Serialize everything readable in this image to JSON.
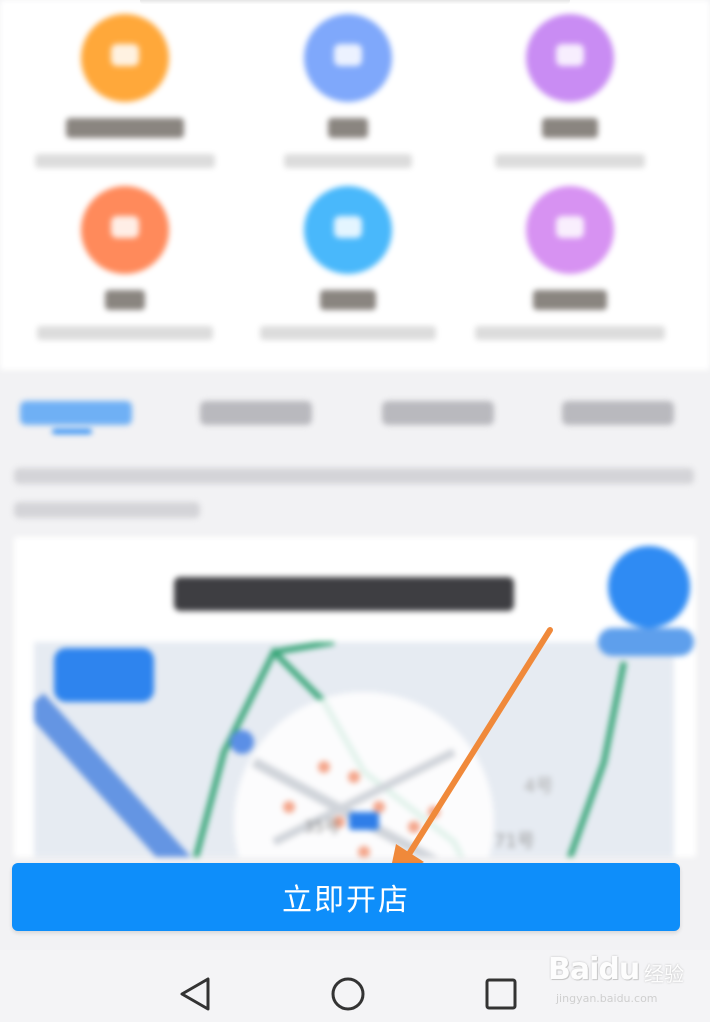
{
  "colors": {
    "accent": "#0e8efa",
    "arrow": "#f0893a",
    "feature_circles": [
      "#ffa83a",
      "#7fa8fb",
      "#c98cf3",
      "#ff8a5b",
      "#49b8fb",
      "#d792f2"
    ]
  },
  "feature_grid": {
    "items": [
      {
        "icon": "sparkle-icon",
        "title": "",
        "desc": ""
      },
      {
        "icon": "cart-icon",
        "title": "",
        "desc": ""
      },
      {
        "icon": "gift-icon",
        "title": "",
        "desc": ""
      },
      {
        "icon": "hand-icon",
        "title": "",
        "desc": ""
      },
      {
        "icon": "coupon-icon",
        "title": "",
        "desc": ""
      },
      {
        "icon": "shield-icon",
        "title": "",
        "desc": ""
      }
    ]
  },
  "tabs": {
    "items": [
      "",
      "",
      "",
      ""
    ],
    "active_index": 0
  },
  "promo": {
    "title": "",
    "map_labels": [
      "35号",
      "71号",
      "4号"
    ]
  },
  "cta": {
    "label": "立即开店"
  },
  "nav": {
    "back": "back-triangle-icon",
    "home": "home-circle-icon",
    "recent": "recent-square-icon"
  },
  "watermark": {
    "logo": "Bai",
    "logo_tail": "du",
    "cn": "经验",
    "url": "jingyan.baidu.com"
  }
}
